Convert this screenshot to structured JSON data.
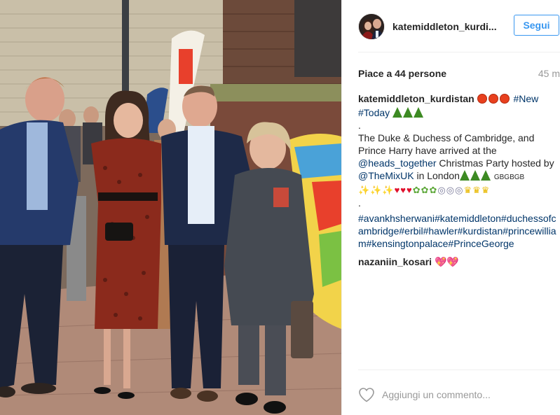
{
  "post": {
    "username": "katemiddleton_kurdi...",
    "follow_label": "Segui",
    "likes": "Piace a 44 persone",
    "time_ago": "45 m"
  },
  "caption": {
    "username": "katemiddleton_kurdistan",
    "new_tag": "#New",
    "today_tag": "#Today",
    "dot": ".",
    "text_1": "The Duke & Duchess of Cambridge, and Prince Harry have arrived at the",
    "mention_1": "@heads_together",
    "text_2": "Christmas Party hosted by",
    "mention_2": "@TheMixUK",
    "text_3": "in London",
    "gb_text": "GBGBGB",
    "hashtags": "#avankhsherwani#katemiddleton#duchessofcambridge#erbil#hawler#kurdistan#princewilliam#kensingtonpalace#PrinceGeorge"
  },
  "comment_2": {
    "username": "nazaniin_kosari",
    "text": "💖💖"
  },
  "footer": {
    "comment_placeholder": "Aggiungi un commento..."
  },
  "icons": {
    "like": "heart-outline-icon",
    "avatar": "profile-avatar"
  },
  "colors": {
    "link": "#003569",
    "follow_blue": "#3897f0",
    "muted": "#999999"
  }
}
